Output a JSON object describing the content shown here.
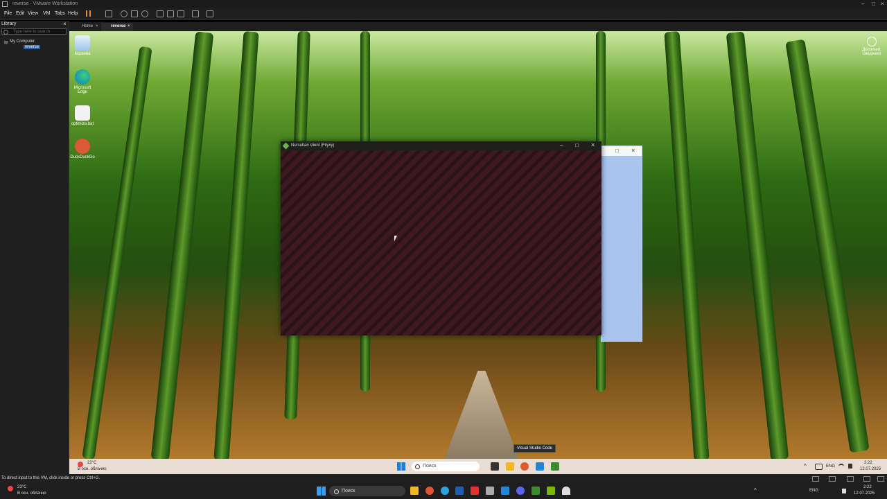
{
  "vmware": {
    "window_title": "reverse - VMware Workstation",
    "menu": [
      "File",
      "Edit",
      "View",
      "VM",
      "Tabs",
      "Help"
    ],
    "library": {
      "header": "Library",
      "search_placeholder": "Type here to search",
      "tree_root": "My Computer",
      "tree_vm": "reverse"
    },
    "tabs": [
      "Home",
      "reverse"
    ],
    "status_text": "To direct input to this VM, click inside or press Ctrl+G."
  },
  "guest": {
    "desktop_icons": [
      "Корзина",
      "Microsoft Edge",
      "optimize.bat",
      "DuckDuckGo"
    ],
    "activation_badge": "Дополнит. сведения",
    "app_window_title": "Nursultan client (Filyxy)",
    "taskbar": {
      "weather_temp": "22°C",
      "weather_desc": "В осн. облачно",
      "search_label": "Поиск",
      "tooltip": "Visual Studio Code",
      "lang": "ENG",
      "time": "2:22",
      "date": "12.07.2025"
    }
  },
  "host": {
    "taskbar": {
      "weather_temp": "23°C",
      "weather_desc": "В осн. облачно",
      "search_label": "Поиск",
      "lang": "ENG",
      "time": "2:22",
      "date": "12.07.2025"
    }
  }
}
